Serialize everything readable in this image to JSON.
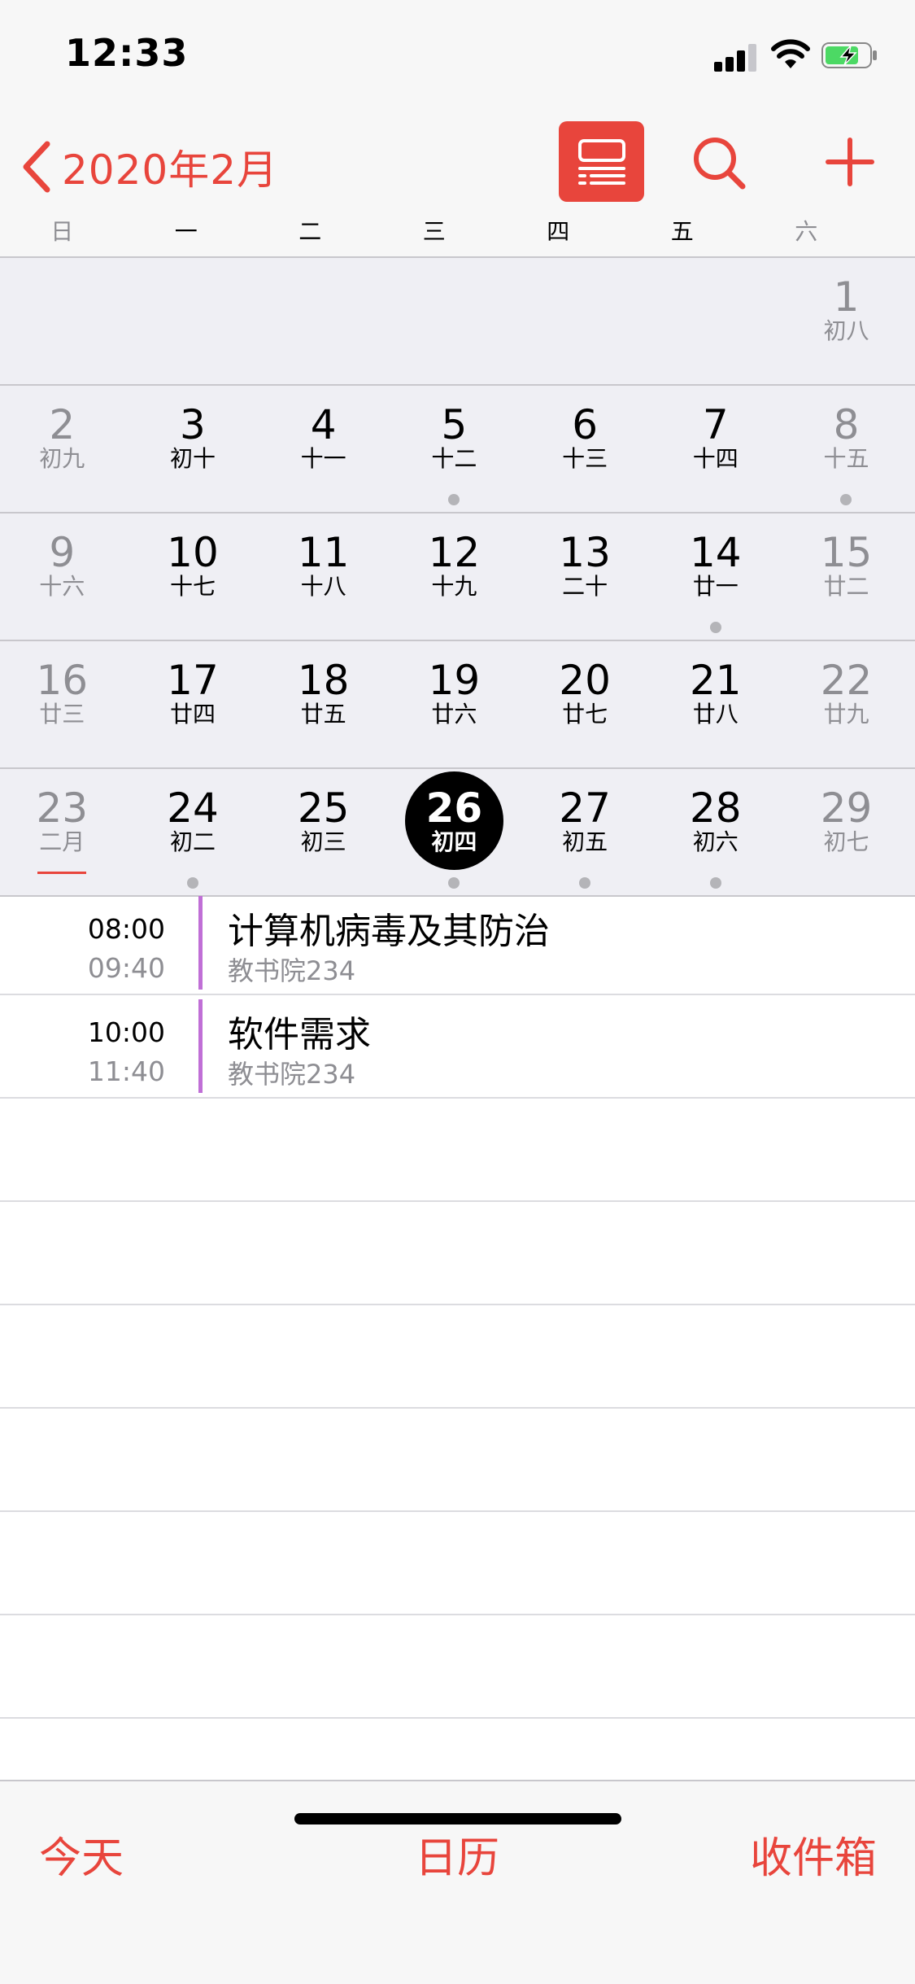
{
  "status_bar": {
    "time": "12:33"
  },
  "nav": {
    "title": "2020年2月",
    "accent_color": "#e8453c"
  },
  "weekdays": [
    "日",
    "一",
    "二",
    "三",
    "四",
    "五",
    "六"
  ],
  "weeks": [
    [
      null,
      null,
      null,
      null,
      null,
      null,
      {
        "day": "1",
        "lunar": "初八",
        "gray": true
      }
    ],
    [
      {
        "day": "2",
        "lunar": "初九",
        "gray": true
      },
      {
        "day": "3",
        "lunar": "初十"
      },
      {
        "day": "4",
        "lunar": "十一"
      },
      {
        "day": "5",
        "lunar": "十二",
        "dot": true
      },
      {
        "day": "6",
        "lunar": "十三"
      },
      {
        "day": "7",
        "lunar": "十四"
      },
      {
        "day": "8",
        "lunar": "十五",
        "gray": true,
        "dot": true
      }
    ],
    [
      {
        "day": "9",
        "lunar": "十六",
        "gray": true
      },
      {
        "day": "10",
        "lunar": "十七"
      },
      {
        "day": "11",
        "lunar": "十八"
      },
      {
        "day": "12",
        "lunar": "十九"
      },
      {
        "day": "13",
        "lunar": "二十"
      },
      {
        "day": "14",
        "lunar": "廿一",
        "dot": true
      },
      {
        "day": "15",
        "lunar": "廿二",
        "gray": true
      }
    ],
    [
      {
        "day": "16",
        "lunar": "廿三",
        "gray": true
      },
      {
        "day": "17",
        "lunar": "廿四"
      },
      {
        "day": "18",
        "lunar": "廿五"
      },
      {
        "day": "19",
        "lunar": "廿六"
      },
      {
        "day": "20",
        "lunar": "廿七"
      },
      {
        "day": "21",
        "lunar": "廿八"
      },
      {
        "day": "22",
        "lunar": "廿九",
        "gray": true
      }
    ],
    [
      {
        "day": "23",
        "lunar": "二月",
        "gray": true,
        "underline": true
      },
      {
        "day": "24",
        "lunar": "初二",
        "dot": true
      },
      {
        "day": "25",
        "lunar": "初三"
      },
      {
        "day": "26",
        "lunar": "初四",
        "selected": true,
        "dot": true
      },
      {
        "day": "27",
        "lunar": "初五",
        "dot": true
      },
      {
        "day": "28",
        "lunar": "初六",
        "dot": true
      },
      {
        "day": "29",
        "lunar": "初七",
        "gray": true
      }
    ]
  ],
  "events": [
    {
      "start": "08:00",
      "end": "09:40",
      "title": "计算机病毒及其防治",
      "location": "教书院234"
    },
    {
      "start": "10:00",
      "end": "11:40",
      "title": "软件需求",
      "location": "教书院234"
    }
  ],
  "tabbar": {
    "today": "今天",
    "calendars": "日历",
    "inbox": "收件箱"
  }
}
